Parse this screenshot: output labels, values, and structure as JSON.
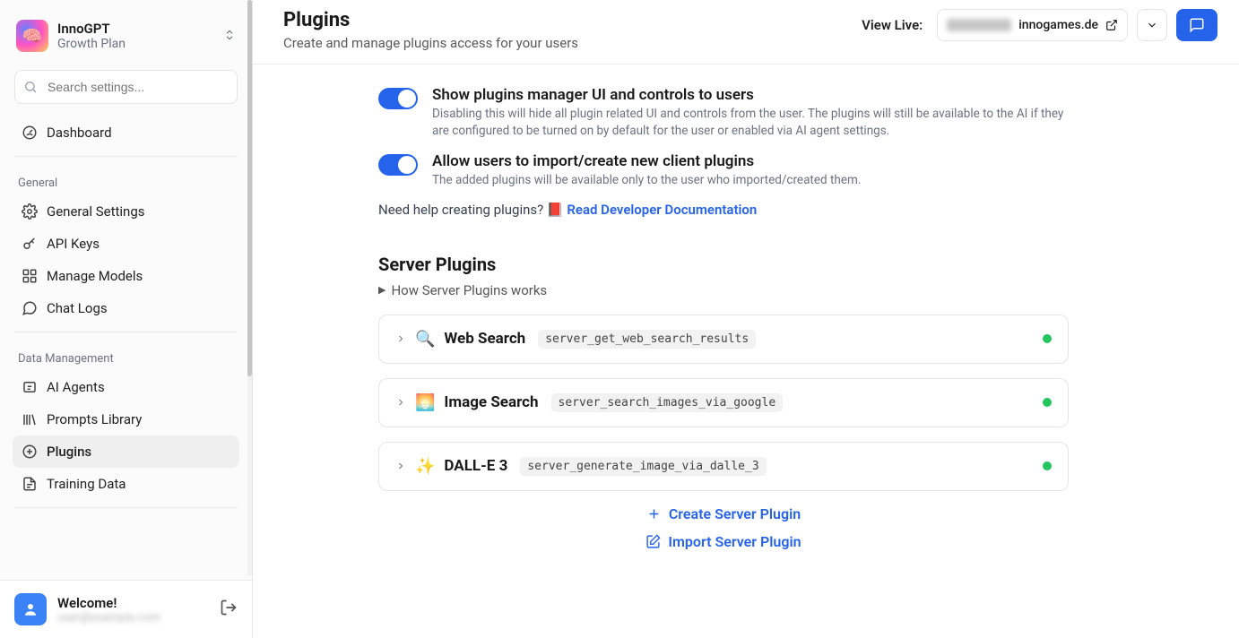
{
  "workspace": {
    "name": "InnoGPT",
    "plan": "Growth Plan"
  },
  "search_placeholder": "Search settings...",
  "nav": {
    "dashboard": "Dashboard"
  },
  "section_general": "General",
  "nav_general": {
    "general_settings": "General Settings",
    "api_keys": "API Keys",
    "manage_models": "Manage Models",
    "chat_logs": "Chat Logs"
  },
  "section_data": "Data Management",
  "nav_data": {
    "ai_agents": "AI Agents",
    "prompts_library": "Prompts Library",
    "plugins": "Plugins",
    "training_data": "Training Data"
  },
  "footer": {
    "welcome": "Welcome!",
    "email_placeholder": "user@example.com"
  },
  "page": {
    "title": "Plugins",
    "subtitle": "Create and manage plugins access for your users"
  },
  "topbar": {
    "view_live": "View Live:",
    "domain": "innogames.de"
  },
  "toggles": {
    "t1": {
      "title": "Show plugins manager UI and controls to users",
      "desc": "Disabling this will hide all plugin related UI and controls from the user. The plugins will still be available to the AI if they are configured to be turned on by default for the user or enabled via AI agent settings."
    },
    "t2": {
      "title": "Allow users to import/create new client plugins",
      "desc": "The added plugins will be available only to the user who imported/created them."
    }
  },
  "help": {
    "text": "Need help creating plugins? 📕 ",
    "link": "Read Developer Documentation"
  },
  "server_plugins": {
    "title": "Server Plugins",
    "how": "How Server Plugins works"
  },
  "plugins": [
    {
      "icon": "🔍",
      "name": "Web Search",
      "id": "server_get_web_search_results"
    },
    {
      "icon": "🌅",
      "name": "Image Search",
      "id": "server_search_images_via_google"
    },
    {
      "icon": "✨",
      "name": "DALL-E 3",
      "id": "server_generate_image_via_dalle_3"
    }
  ],
  "actions": {
    "create": "Create Server Plugin",
    "import": "Import Server Plugin"
  }
}
